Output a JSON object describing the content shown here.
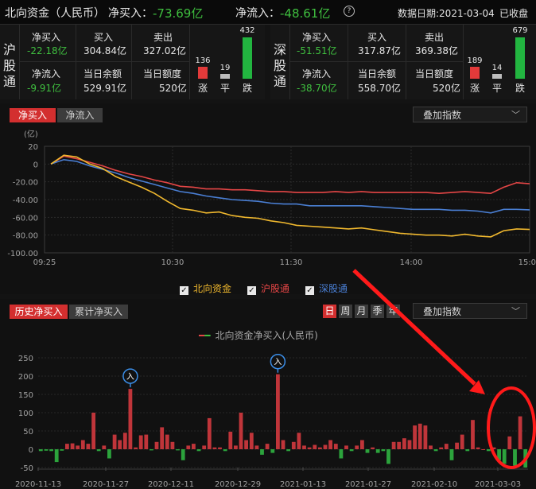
{
  "header": {
    "title": "北向资金（人民币）",
    "net_buy_label": "净买入：",
    "net_buy_value": "-73.69亿",
    "net_inflow_label": "净流入：",
    "net_inflow_value": "-48.61亿",
    "help_icon": "question-circle-icon",
    "date_label": "数据日期:2021-03-04",
    "status": "已收盘"
  },
  "shanghai": {
    "name_chars": [
      "沪",
      "股",
      "通"
    ],
    "net_buy_label": "净买入",
    "net_buy_value": "-22.18亿",
    "buy_label": "买入",
    "buy_value": "304.84亿",
    "sell_label": "卖出",
    "sell_value": "327.02亿",
    "net_inflow_label": "净流入",
    "net_inflow_value": "-9.91亿",
    "balance_label": "当日余额",
    "balance_value": "529.91亿",
    "quota_label": "当日额度",
    "quota_value": "520亿",
    "up_count": "136",
    "flat_count": "19",
    "down_count": "432",
    "up_label": "涨",
    "flat_label": "平",
    "down_label": "跌"
  },
  "shenzhen": {
    "name_chars": [
      "深",
      "股",
      "通"
    ],
    "net_buy_label": "净买入",
    "net_buy_value": "-51.51亿",
    "buy_label": "买入",
    "buy_value": "317.87亿",
    "sell_label": "卖出",
    "sell_value": "369.38亿",
    "net_inflow_label": "净流入",
    "net_inflow_value": "-38.70亿",
    "balance_label": "当日余额",
    "balance_value": "558.70亿",
    "quota_label": "当日额度",
    "quota_value": "520亿",
    "up_count": "189",
    "flat_count": "14",
    "down_count": "679",
    "up_label": "涨",
    "flat_label": "平",
    "down_label": "跌"
  },
  "intraday": {
    "tabs": [
      "净买入",
      "净流入"
    ],
    "overlay_label": "叠加指数",
    "legend": [
      "北向资金",
      "沪股通",
      "深股通"
    ],
    "colors": {
      "north": "#f0b82e",
      "sh": "#e54646",
      "sz": "#4a7fd4"
    }
  },
  "history": {
    "tabs": [
      "历史净买入",
      "累计净买入"
    ],
    "periods": [
      "日",
      "周",
      "月",
      "季",
      "年"
    ],
    "overlay_label": "叠加指数",
    "legend_title": "北向资金净买入(人民币)",
    "marker_label": "入"
  },
  "chart_data": [
    {
      "type": "line",
      "ylabel": "(亿)",
      "ylim": [
        -100,
        20
      ],
      "yticks": [
        "20",
        "0",
        "-20.00",
        "-40.00",
        "-60.00",
        "-80.00",
        "-100.00"
      ],
      "xticks": [
        "09:25",
        "10:30",
        "11:30",
        "14:00",
        "15:00"
      ],
      "series": [
        {
          "name": "北向资金",
          "values": [
            0,
            10,
            8,
            0,
            -5,
            -14,
            -20,
            -26,
            -33,
            -42,
            -50,
            -52,
            -55,
            -54,
            -58,
            -60,
            -61,
            -64,
            -66,
            -69,
            -70,
            -71,
            -72,
            -73,
            -72,
            -74,
            -76,
            -78,
            -79,
            -80,
            -80,
            -81,
            -79,
            -81,
            -82,
            -75,
            -73,
            -73.69
          ]
        },
        {
          "name": "沪股通",
          "values": [
            0,
            9,
            6,
            2,
            -2,
            -7,
            -11,
            -14,
            -18,
            -21,
            -25,
            -26,
            -28,
            -28,
            -29,
            -29,
            -30,
            -31,
            -31,
            -32,
            -32,
            -32,
            -31,
            -32,
            -31,
            -32,
            -32,
            -32,
            -32,
            -32,
            -33,
            -32,
            -31,
            -32,
            -33,
            -26,
            -21,
            -22.18
          ]
        },
        {
          "name": "深股通",
          "values": [
            0,
            5,
            3,
            -2,
            -6,
            -10,
            -15,
            -19,
            -23,
            -27,
            -31,
            -33,
            -36,
            -38,
            -40,
            -41,
            -42,
            -44,
            -45,
            -45,
            -47,
            -47,
            -47,
            -47,
            -47,
            -48,
            -49,
            -50,
            -51,
            -51,
            -51,
            -52,
            -52,
            -53,
            -55,
            -51,
            -51,
            -51.51
          ]
        }
      ]
    },
    {
      "type": "bar",
      "title": "北向资金净买入(人民币)",
      "ylim": [
        -50,
        250
      ],
      "yticks": [
        "250",
        "200",
        "150",
        "100",
        "50",
        "0",
        "-50"
      ],
      "xticks": [
        "2020-11-13",
        "2020-11-27",
        "2020-12-11",
        "2020-12-29",
        "2021-01-13",
        "2021-01-27",
        "2021-02-10",
        "2021-03-03"
      ],
      "values": [
        -5,
        -4,
        -5,
        -35,
        -4,
        15,
        16,
        10,
        25,
        15,
        100,
        -5,
        10,
        -25,
        40,
        25,
        45,
        165,
        5,
        38,
        40,
        -3,
        20,
        60,
        40,
        20,
        -3,
        -30,
        10,
        15,
        -5,
        10,
        85,
        5,
        5,
        -5,
        48,
        10,
        100,
        25,
        45,
        10,
        -15,
        15,
        -10,
        205,
        25,
        -5,
        20,
        45,
        10,
        5,
        12,
        5,
        12,
        25,
        15,
        -25,
        10,
        -5,
        10,
        25,
        -10,
        5,
        -10,
        -5,
        -40,
        20,
        20,
        30,
        25,
        65,
        70,
        65,
        10,
        -5,
        5,
        15,
        -30,
        18,
        40,
        -5,
        80,
        5,
        0,
        -5,
        5,
        -30,
        -40,
        35,
        -45,
        90,
        -50
      ]
    }
  ]
}
